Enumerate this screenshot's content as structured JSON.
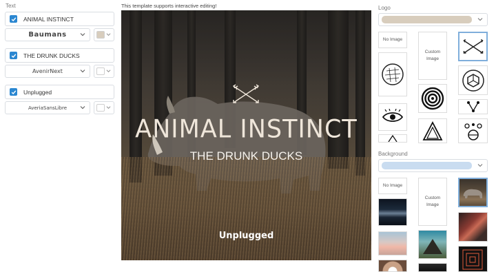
{
  "text_panel": {
    "section_label": "Text",
    "rows": [
      {
        "checked": true,
        "value": "ANIMAL INSTINCT",
        "font": "Baumans",
        "color": "#d8cdbd"
      },
      {
        "checked": true,
        "value": "THE DRUNK DUCKS",
        "font": "AvenirNext",
        "color": "#ffffff"
      },
      {
        "checked": true,
        "value": "Unplugged",
        "font": "AveriaSansLibre",
        "color": "#ffffff"
      }
    ]
  },
  "preview": {
    "hint": "This template supports interactive editing!",
    "title": "ANIMAL INSTINCT",
    "subtitle": "THE DRUNK DUCKS",
    "footer": "Unplugged"
  },
  "logo_panel": {
    "section_label": "Logo",
    "selected_color": "#d8cdbd",
    "no_image_label": "No Image",
    "custom_image_label": "Custom Image",
    "tiles": [
      "no-image",
      "custom-image",
      "arrows-logo",
      "engraved-circle-logo",
      "hexagon-logo",
      "eye-logo",
      "concentric-circles-logo",
      "triangle-logo",
      "triangle-nodes-logo",
      "planets-logo"
    ],
    "selected_tile": "arrows-logo"
  },
  "background_panel": {
    "section_label": "Background",
    "selected_color": "#c9dcf0",
    "no_image_label": "No Image",
    "custom_image_label": "Custom Image",
    "selected_tile": "rhino-photo",
    "photos": [
      "mountain-night-photo",
      "road-photo",
      "beach-photo",
      "pyramid-photo",
      "rhino-photo",
      "vinyl-photo",
      "neon-photo",
      "dark-squares-photo"
    ]
  }
}
